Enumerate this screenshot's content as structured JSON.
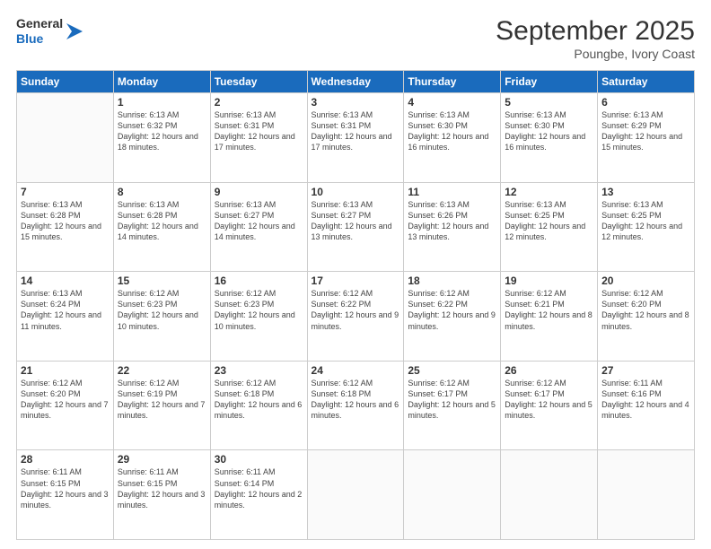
{
  "logo": {
    "line1": "General",
    "line2": "Blue"
  },
  "header": {
    "month": "September 2025",
    "location": "Poungbe, Ivory Coast"
  },
  "weekdays": [
    "Sunday",
    "Monday",
    "Tuesday",
    "Wednesday",
    "Thursday",
    "Friday",
    "Saturday"
  ],
  "weeks": [
    [
      {
        "day": "",
        "info": ""
      },
      {
        "day": "1",
        "info": "Sunrise: 6:13 AM\nSunset: 6:32 PM\nDaylight: 12 hours\nand 18 minutes."
      },
      {
        "day": "2",
        "info": "Sunrise: 6:13 AM\nSunset: 6:31 PM\nDaylight: 12 hours\nand 17 minutes."
      },
      {
        "day": "3",
        "info": "Sunrise: 6:13 AM\nSunset: 6:31 PM\nDaylight: 12 hours\nand 17 minutes."
      },
      {
        "day": "4",
        "info": "Sunrise: 6:13 AM\nSunset: 6:30 PM\nDaylight: 12 hours\nand 16 minutes."
      },
      {
        "day": "5",
        "info": "Sunrise: 6:13 AM\nSunset: 6:30 PM\nDaylight: 12 hours\nand 16 minutes."
      },
      {
        "day": "6",
        "info": "Sunrise: 6:13 AM\nSunset: 6:29 PM\nDaylight: 12 hours\nand 15 minutes."
      }
    ],
    [
      {
        "day": "7",
        "info": "Sunrise: 6:13 AM\nSunset: 6:28 PM\nDaylight: 12 hours\nand 15 minutes."
      },
      {
        "day": "8",
        "info": "Sunrise: 6:13 AM\nSunset: 6:28 PM\nDaylight: 12 hours\nand 14 minutes."
      },
      {
        "day": "9",
        "info": "Sunrise: 6:13 AM\nSunset: 6:27 PM\nDaylight: 12 hours\nand 14 minutes."
      },
      {
        "day": "10",
        "info": "Sunrise: 6:13 AM\nSunset: 6:27 PM\nDaylight: 12 hours\nand 13 minutes."
      },
      {
        "day": "11",
        "info": "Sunrise: 6:13 AM\nSunset: 6:26 PM\nDaylight: 12 hours\nand 13 minutes."
      },
      {
        "day": "12",
        "info": "Sunrise: 6:13 AM\nSunset: 6:25 PM\nDaylight: 12 hours\nand 12 minutes."
      },
      {
        "day": "13",
        "info": "Sunrise: 6:13 AM\nSunset: 6:25 PM\nDaylight: 12 hours\nand 12 minutes."
      }
    ],
    [
      {
        "day": "14",
        "info": "Sunrise: 6:13 AM\nSunset: 6:24 PM\nDaylight: 12 hours\nand 11 minutes."
      },
      {
        "day": "15",
        "info": "Sunrise: 6:12 AM\nSunset: 6:23 PM\nDaylight: 12 hours\nand 10 minutes."
      },
      {
        "day": "16",
        "info": "Sunrise: 6:12 AM\nSunset: 6:23 PM\nDaylight: 12 hours\nand 10 minutes."
      },
      {
        "day": "17",
        "info": "Sunrise: 6:12 AM\nSunset: 6:22 PM\nDaylight: 12 hours\nand 9 minutes."
      },
      {
        "day": "18",
        "info": "Sunrise: 6:12 AM\nSunset: 6:22 PM\nDaylight: 12 hours\nand 9 minutes."
      },
      {
        "day": "19",
        "info": "Sunrise: 6:12 AM\nSunset: 6:21 PM\nDaylight: 12 hours\nand 8 minutes."
      },
      {
        "day": "20",
        "info": "Sunrise: 6:12 AM\nSunset: 6:20 PM\nDaylight: 12 hours\nand 8 minutes."
      }
    ],
    [
      {
        "day": "21",
        "info": "Sunrise: 6:12 AM\nSunset: 6:20 PM\nDaylight: 12 hours\nand 7 minutes."
      },
      {
        "day": "22",
        "info": "Sunrise: 6:12 AM\nSunset: 6:19 PM\nDaylight: 12 hours\nand 7 minutes."
      },
      {
        "day": "23",
        "info": "Sunrise: 6:12 AM\nSunset: 6:18 PM\nDaylight: 12 hours\nand 6 minutes."
      },
      {
        "day": "24",
        "info": "Sunrise: 6:12 AM\nSunset: 6:18 PM\nDaylight: 12 hours\nand 6 minutes."
      },
      {
        "day": "25",
        "info": "Sunrise: 6:12 AM\nSunset: 6:17 PM\nDaylight: 12 hours\nand 5 minutes."
      },
      {
        "day": "26",
        "info": "Sunrise: 6:12 AM\nSunset: 6:17 PM\nDaylight: 12 hours\nand 5 minutes."
      },
      {
        "day": "27",
        "info": "Sunrise: 6:11 AM\nSunset: 6:16 PM\nDaylight: 12 hours\nand 4 minutes."
      }
    ],
    [
      {
        "day": "28",
        "info": "Sunrise: 6:11 AM\nSunset: 6:15 PM\nDaylight: 12 hours\nand 3 minutes."
      },
      {
        "day": "29",
        "info": "Sunrise: 6:11 AM\nSunset: 6:15 PM\nDaylight: 12 hours\nand 3 minutes."
      },
      {
        "day": "30",
        "info": "Sunrise: 6:11 AM\nSunset: 6:14 PM\nDaylight: 12 hours\nand 2 minutes."
      },
      {
        "day": "",
        "info": ""
      },
      {
        "day": "",
        "info": ""
      },
      {
        "day": "",
        "info": ""
      },
      {
        "day": "",
        "info": ""
      }
    ]
  ]
}
